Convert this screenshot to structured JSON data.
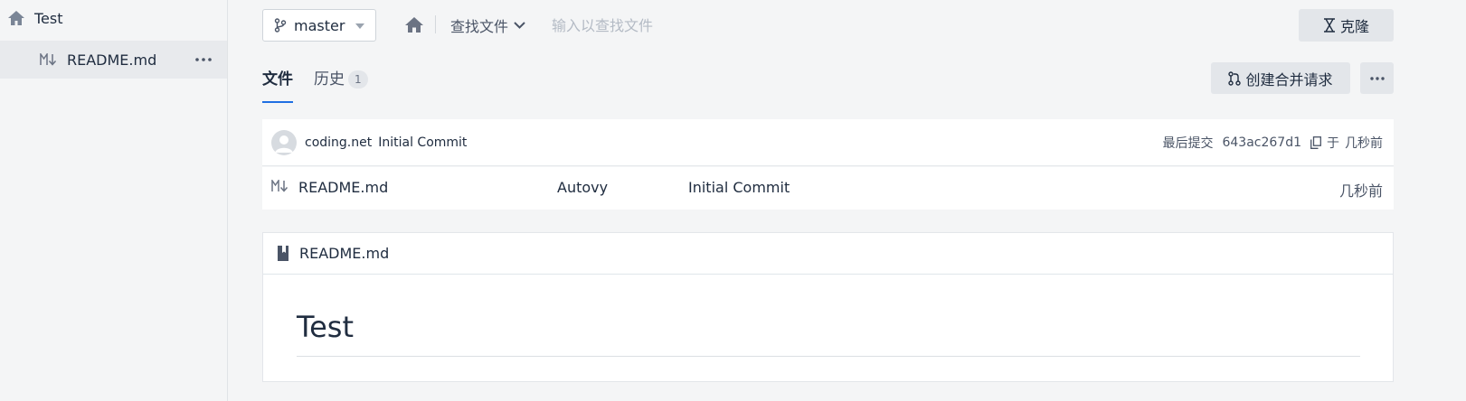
{
  "sidebar": {
    "root_label": "Test",
    "file_label": "README.md"
  },
  "toolbar": {
    "branch": "master",
    "find_file_label": "查找文件",
    "search_placeholder": "输入以查找文件",
    "clone_label": "克隆"
  },
  "tabs": {
    "files_label": "文件",
    "history_label": "历史",
    "history_count": "1",
    "merge_request_label": "创建合并请求"
  },
  "commit": {
    "author": "coding.net",
    "message": "Initial Commit",
    "last_commit_label": "最后提交",
    "hash": "643ac267d1",
    "time_prefix": "于",
    "time": "几秒前"
  },
  "files": [
    {
      "name": "README.md",
      "author": "Autovy",
      "message": "Initial Commit",
      "time": "几秒前"
    }
  ],
  "readme": {
    "file_name": "README.md",
    "heading": "Test"
  },
  "colors": {
    "accent": "#1f6fe3",
    "text": "#202d40",
    "muted": "#4a5466",
    "button_bg": "#e3e6ea"
  },
  "icons": {
    "home": "home-icon",
    "markdown": "markdown-icon",
    "branch": "git-branch-icon",
    "clone": "clone-icon",
    "merge": "merge-request-icon",
    "more": "more-horizontal-icon",
    "copy": "copy-icon",
    "book": "book-icon",
    "avatar": "user-avatar"
  }
}
